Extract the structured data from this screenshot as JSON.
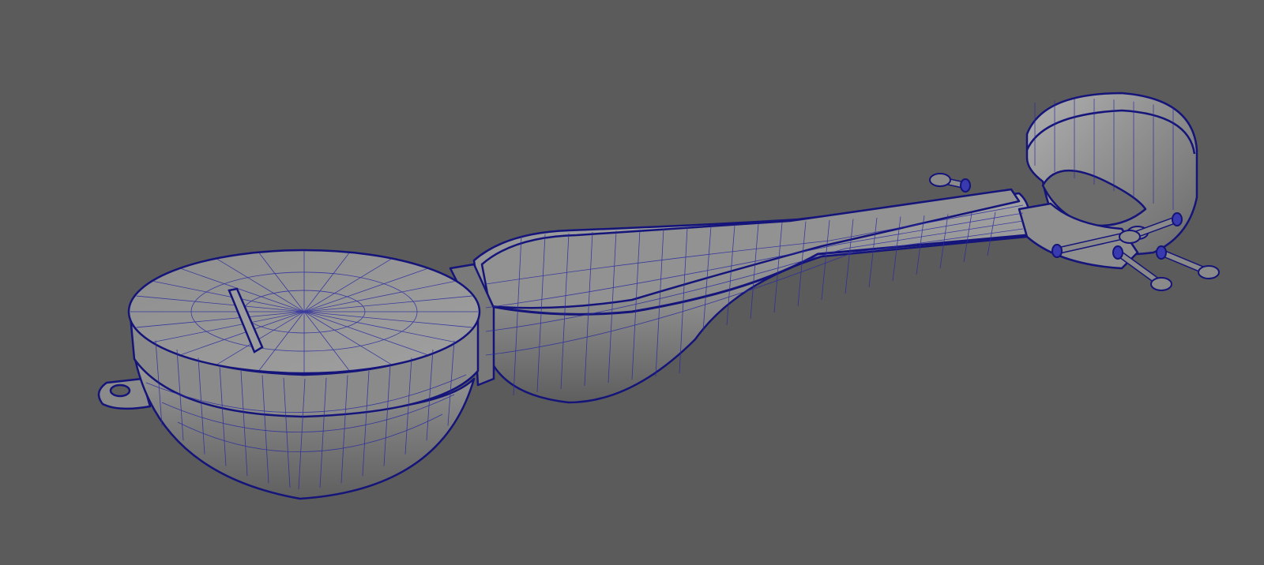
{
  "viewport": {
    "background_color": "#5b5b5b",
    "model_fill_color": "#8c8c8c",
    "wireframe_color": "#14147a",
    "object": "string-instrument-model-wireframe-on-shaded"
  }
}
